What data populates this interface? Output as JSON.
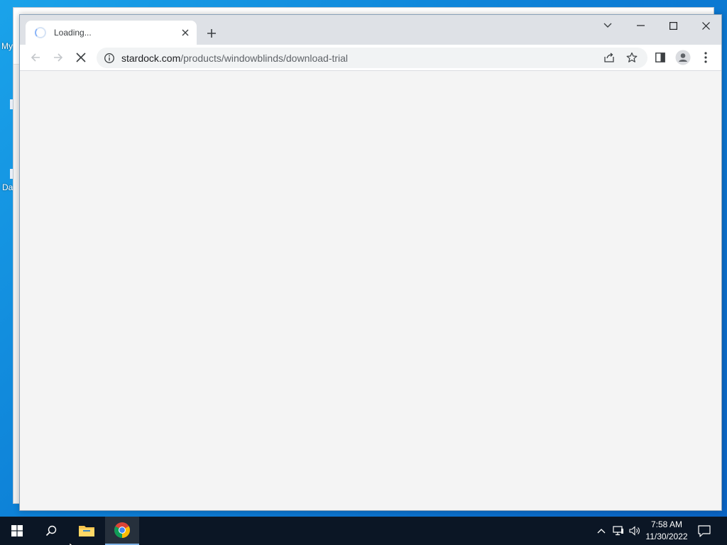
{
  "desktop": {
    "icon_label_1": "My",
    "icon_label_2": "Da"
  },
  "browser": {
    "tab": {
      "title": "Loading...",
      "state": "loading"
    },
    "omnibox": {
      "host": "stardock.com",
      "path": "/products/windowblinds/download-trial"
    },
    "nav_state": {
      "back_enabled": false,
      "forward_enabled": false,
      "loading": true
    }
  },
  "taskbar": {
    "clock_time": "7:58 AM",
    "clock_date": "11/30/2022",
    "pinned": [
      "start",
      "search",
      "file-explorer",
      "chrome"
    ],
    "active_app": "chrome"
  },
  "colors": {
    "desktop_blue": "#0d7fd6",
    "taskbar": "#0b1625",
    "tabstrip": "#dee1e6",
    "omnibox_bg": "#f1f3f4"
  }
}
